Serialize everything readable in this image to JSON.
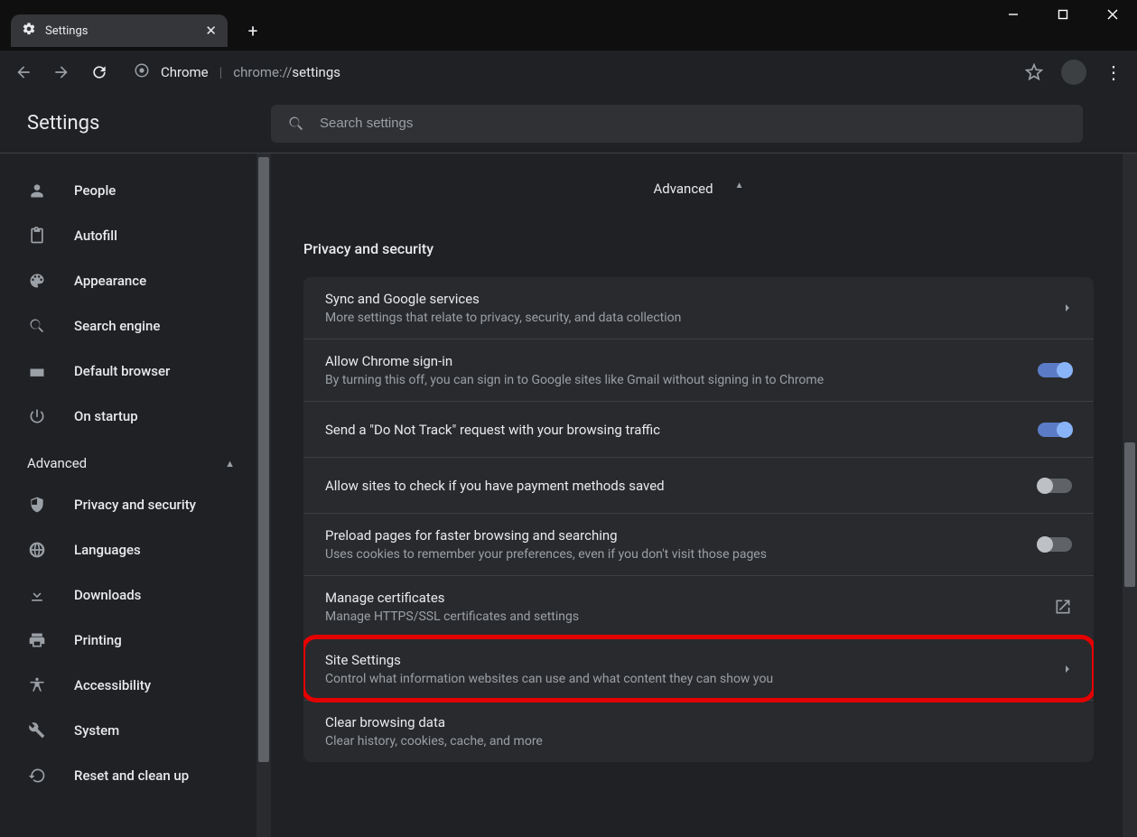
{
  "window": {
    "tab_title": "Settings"
  },
  "omnibox": {
    "app": "Chrome",
    "url_prefix": "chrome://",
    "url_path": "settings"
  },
  "header": {
    "title": "Settings",
    "search_placeholder": "Search settings"
  },
  "sidebar": {
    "items": [
      {
        "label": "People"
      },
      {
        "label": "Autofill"
      },
      {
        "label": "Appearance"
      },
      {
        "label": "Search engine"
      },
      {
        "label": "Default browser"
      },
      {
        "label": "On startup"
      }
    ],
    "advanced_label": "Advanced",
    "adv_items": [
      {
        "label": "Privacy and security"
      },
      {
        "label": "Languages"
      },
      {
        "label": "Downloads"
      },
      {
        "label": "Printing"
      },
      {
        "label": "Accessibility"
      },
      {
        "label": "System"
      },
      {
        "label": "Reset and clean up"
      }
    ]
  },
  "content": {
    "advanced_label": "Advanced",
    "section_title": "Privacy and security",
    "rows": {
      "sync": {
        "title": "Sync and Google services",
        "sub": "More settings that relate to privacy, security, and data collection"
      },
      "signin": {
        "title": "Allow Chrome sign-in",
        "sub": "By turning this off, you can sign in to Google sites like Gmail without signing in to Chrome"
      },
      "dnt": {
        "title": "Send a \"Do Not Track\" request with your browsing traffic"
      },
      "payment": {
        "title": "Allow sites to check if you have payment methods saved"
      },
      "preload": {
        "title": "Preload pages for faster browsing and searching",
        "sub": "Uses cookies to remember your preferences, even if you don't visit those pages"
      },
      "certs": {
        "title": "Manage certificates",
        "sub": "Manage HTTPS/SSL certificates and settings"
      },
      "site": {
        "title": "Site Settings",
        "sub": "Control what information websites can use and what content they can show you"
      },
      "clear": {
        "title": "Clear browsing data",
        "sub": "Clear history, cookies, cache, and more"
      }
    }
  }
}
